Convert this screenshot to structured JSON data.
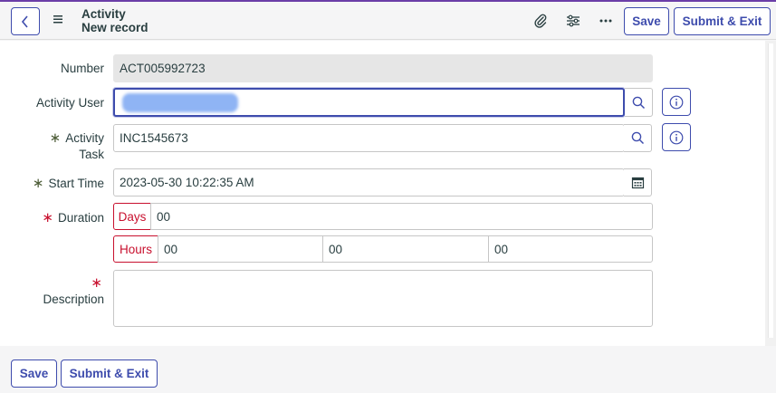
{
  "header": {
    "title": "Activity",
    "subtitle": "New record",
    "save_label": "Save",
    "submit_exit_label": "Submit & Exit"
  },
  "icons": {
    "back": "chevron-left-icon",
    "menu": "hamburger-menu-icon",
    "attachment": "paperclip-icon",
    "personalize": "sliders-icon",
    "more": "ellipsis-icon",
    "search": "search-icon",
    "info": "info-icon",
    "calendar": "calendar-icon"
  },
  "form": {
    "number": {
      "label": "Number",
      "value": "ACT005992723"
    },
    "activity_user": {
      "label": "Activity User",
      "value": ""
    },
    "activity_task": {
      "label_line1": "Activity",
      "label_line2": "Task",
      "mandatory": "∗",
      "value": "INC1545673"
    },
    "start_time": {
      "label": "Start Time",
      "mandatory": "∗",
      "value": "2023-05-30 10:22:35 AM"
    },
    "duration": {
      "label": "Duration",
      "mandatory": "∗",
      "days_label": "Days",
      "days_value": "00",
      "hours_label": "Hours",
      "hours_value": "00",
      "minutes_value": "00",
      "seconds_value": "00"
    },
    "description": {
      "label": "Description",
      "mandatory": "∗",
      "value": ""
    }
  },
  "footer": {
    "save_label": "Save",
    "submit_exit_label": "Submit & Exit"
  },
  "colors": {
    "accent": "#3e4cad",
    "mandatory_red": "#c8102e",
    "mandatory_gray": "#4b5b35",
    "top_strip": "#6b3ea8"
  }
}
